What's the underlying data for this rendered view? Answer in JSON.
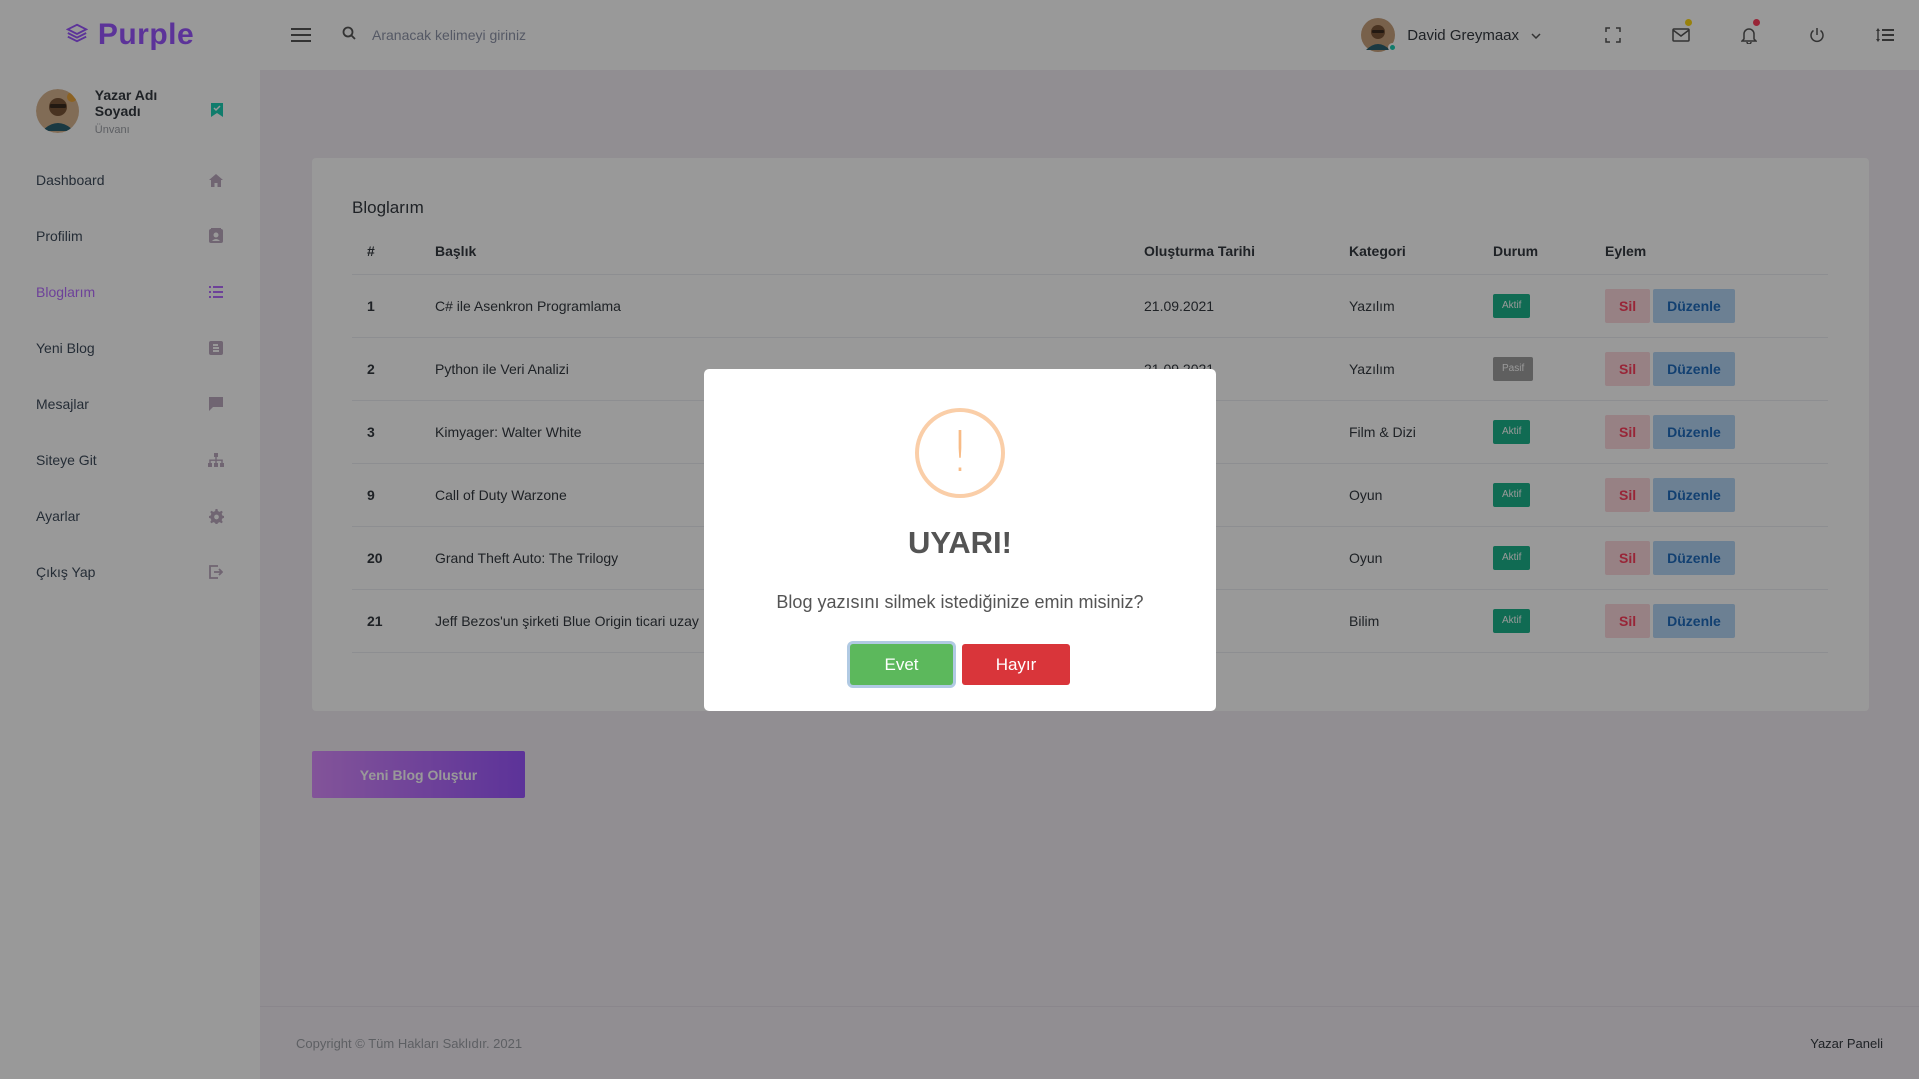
{
  "brand": {
    "name": "Purple"
  },
  "search": {
    "placeholder": "Aranacak kelimeyi giriniz"
  },
  "user": {
    "name": "David Greymaax"
  },
  "sidebar": {
    "profile": {
      "name": "Yazar Adı Soyadı",
      "role": "Ünvanı"
    },
    "items": [
      {
        "label": "Dashboard",
        "icon": "home-icon"
      },
      {
        "label": "Profilim",
        "icon": "contact-card-icon"
      },
      {
        "label": "Bloglarım",
        "icon": "list-icon",
        "active": true
      },
      {
        "label": "Yeni Blog",
        "icon": "blog-icon"
      },
      {
        "label": "Mesajlar",
        "icon": "message-icon"
      },
      {
        "label": "Siteye Git",
        "icon": "sitemap-icon"
      },
      {
        "label": "Ayarlar",
        "icon": "gear-icon"
      },
      {
        "label": "Çıkış Yap",
        "icon": "logout-icon"
      }
    ]
  },
  "blogs": {
    "title": "Bloglarım",
    "columns": [
      "#",
      "Başlık",
      "Oluşturma Tarihi",
      "Kategori",
      "Durum",
      "Eylem"
    ],
    "rows": [
      {
        "id": "1",
        "title": "C# ile Asenkron Programlama",
        "date": "21.09.2021",
        "category": "Yazılım",
        "status": "Aktif"
      },
      {
        "id": "2",
        "title": "Python ile Veri Analizi",
        "date": "21.09.2021",
        "category": "Yazılım",
        "status": "Pasif"
      },
      {
        "id": "3",
        "title": "Kimyager: Walter White",
        "date": "",
        "category": "Film & Dizi",
        "status": "Aktif"
      },
      {
        "id": "9",
        "title": "Call of Duty Warzone",
        "date": "",
        "category": "Oyun",
        "status": "Aktif"
      },
      {
        "id": "20",
        "title": "Grand Theft Auto: The Trilogy",
        "date": "",
        "category": "Oyun",
        "status": "Aktif"
      },
      {
        "id": "21",
        "title": "Jeff Bezos'un şirketi Blue Origin ticari uzay",
        "date": "",
        "category": "Bilim",
        "status": "Aktif"
      }
    ],
    "delete_label": "Sil",
    "edit_label": "Düzenle"
  },
  "create_button": "Yeni Blog Oluştur",
  "footer": {
    "copyright": "Copyright © Tüm Hakları Saklıdır. 2021",
    "panel": "Yazar Paneli"
  },
  "modal": {
    "icon": "!",
    "title": "UYARI!",
    "text": "Blog yazısını silmek istediğinize emin misiniz?",
    "confirm": "Evet",
    "cancel": "Hayır"
  },
  "colors": {
    "accent": "#b66dff",
    "active_status": "#1bb38a",
    "passive_status": "#9e9e9e",
    "confirm": "#5cb85c",
    "cancel": "#d9353a"
  }
}
